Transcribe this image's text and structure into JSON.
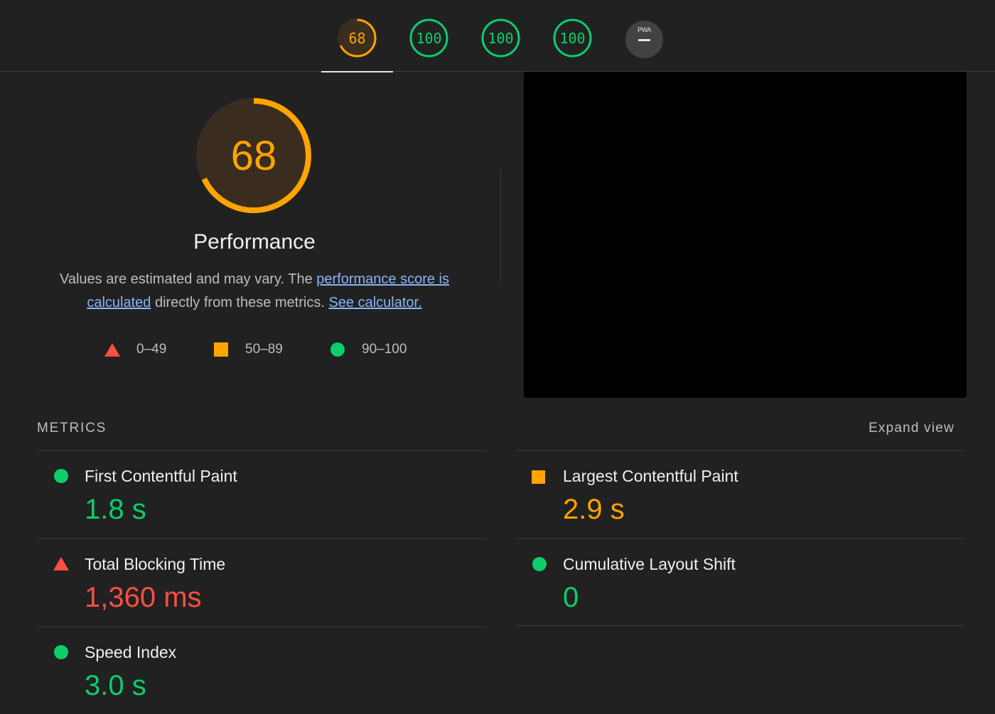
{
  "tabs": [
    {
      "label": "68",
      "score": 68,
      "color": "#ffa400",
      "selected": true
    },
    {
      "label": "100",
      "score": 100,
      "color": "#0cce6b",
      "selected": false
    },
    {
      "label": "100",
      "score": 100,
      "color": "#0cce6b",
      "selected": false
    },
    {
      "label": "100",
      "score": 100,
      "color": "#0cce6b",
      "selected": false
    }
  ],
  "pwa": {
    "label": "PWA",
    "icon": "pwa-icon"
  },
  "performance": {
    "score": "68",
    "score_value": 68,
    "title": "Performance",
    "desc_prefix": "Values are estimated and may vary. The ",
    "desc_link1": "performance score is calculated",
    "desc_middle": " directly from these metrics. ",
    "desc_link2": "See calculator."
  },
  "legend": [
    {
      "range": "0–49",
      "icon": "fail-triangle-icon",
      "color": "#ff4e42"
    },
    {
      "range": "50–89",
      "icon": "average-square-icon",
      "color": "#ffa400"
    },
    {
      "range": "90–100",
      "icon": "pass-circle-icon",
      "color": "#0cce6b"
    }
  ],
  "metrics": {
    "header": "METRICS",
    "expand_label": "Expand view",
    "items": [
      {
        "name": "First Contentful Paint",
        "value": "1.8 s",
        "rating": "pass"
      },
      {
        "name": "Largest Contentful Paint",
        "value": "2.9 s",
        "rating": "average"
      },
      {
        "name": "Total Blocking Time",
        "value": "1,360 ms",
        "rating": "fail"
      },
      {
        "name": "Cumulative Layout Shift",
        "value": "0",
        "rating": "pass"
      },
      {
        "name": "Speed Index",
        "value": "3.0 s",
        "rating": "pass"
      }
    ]
  },
  "colors": {
    "pass": "#0cce6b",
    "average": "#ffa400",
    "fail": "#ff4e42",
    "background": "#212121",
    "link": "#8ab4f8"
  }
}
